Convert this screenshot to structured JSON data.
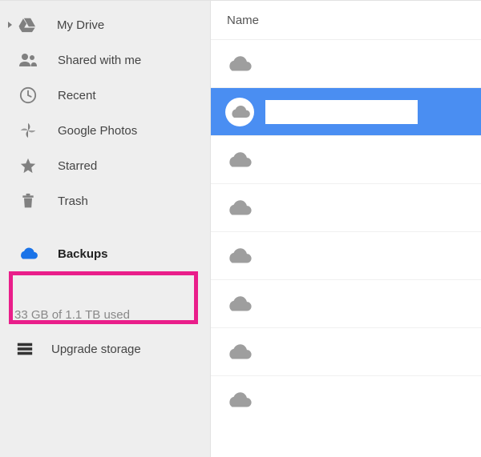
{
  "sidebar": {
    "items": [
      {
        "label": "My Drive"
      },
      {
        "label": "Shared with me"
      },
      {
        "label": "Recent"
      },
      {
        "label": "Google Photos"
      },
      {
        "label": "Starred"
      },
      {
        "label": "Trash"
      },
      {
        "label": "Backups"
      }
    ],
    "storage_text": "33 GB of 1.1 TB used",
    "upgrade_label": "Upgrade storage"
  },
  "main": {
    "header_name": "Name",
    "rows": [
      {
        "name": "",
        "selected": false
      },
      {
        "name": "",
        "selected": true
      },
      {
        "name": "",
        "selected": false
      },
      {
        "name": "",
        "selected": false
      },
      {
        "name": "",
        "selected": false
      },
      {
        "name": "",
        "selected": false
      },
      {
        "name": "",
        "selected": false
      },
      {
        "name": "",
        "selected": false
      }
    ]
  },
  "colors": {
    "accent_blue": "#4a8ef2",
    "highlight_pink": "#e91e8a",
    "icon_gray": "#808080",
    "selected_icon_blue": "#1a73e8"
  }
}
